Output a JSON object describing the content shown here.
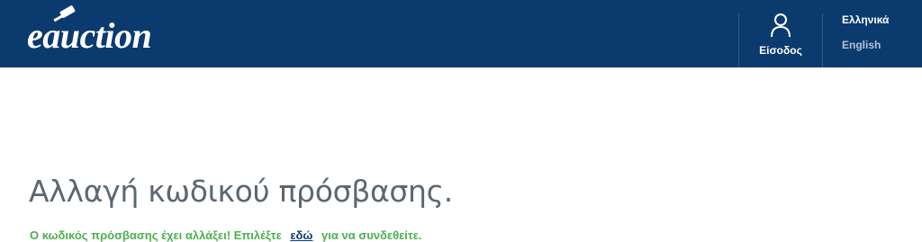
{
  "header": {
    "logo_text": "eauction",
    "login_label": "Είσοδος",
    "languages": [
      "Ελληνικά",
      "English"
    ]
  },
  "main": {
    "title": "Αλλαγή κωδικού πρόσβασης.",
    "message_before": "Ο κωδικός πρόσβασης έχει αλλάξει! Επιλέξτε",
    "link_text": "εδώ",
    "message_after": "για να συνδεθείτε."
  },
  "colors": {
    "header_bg": "#0b3a6e",
    "success_text": "#4caf50",
    "title_text": "#5c6770"
  },
  "icons": [
    "gavel-icon",
    "user-icon"
  ]
}
